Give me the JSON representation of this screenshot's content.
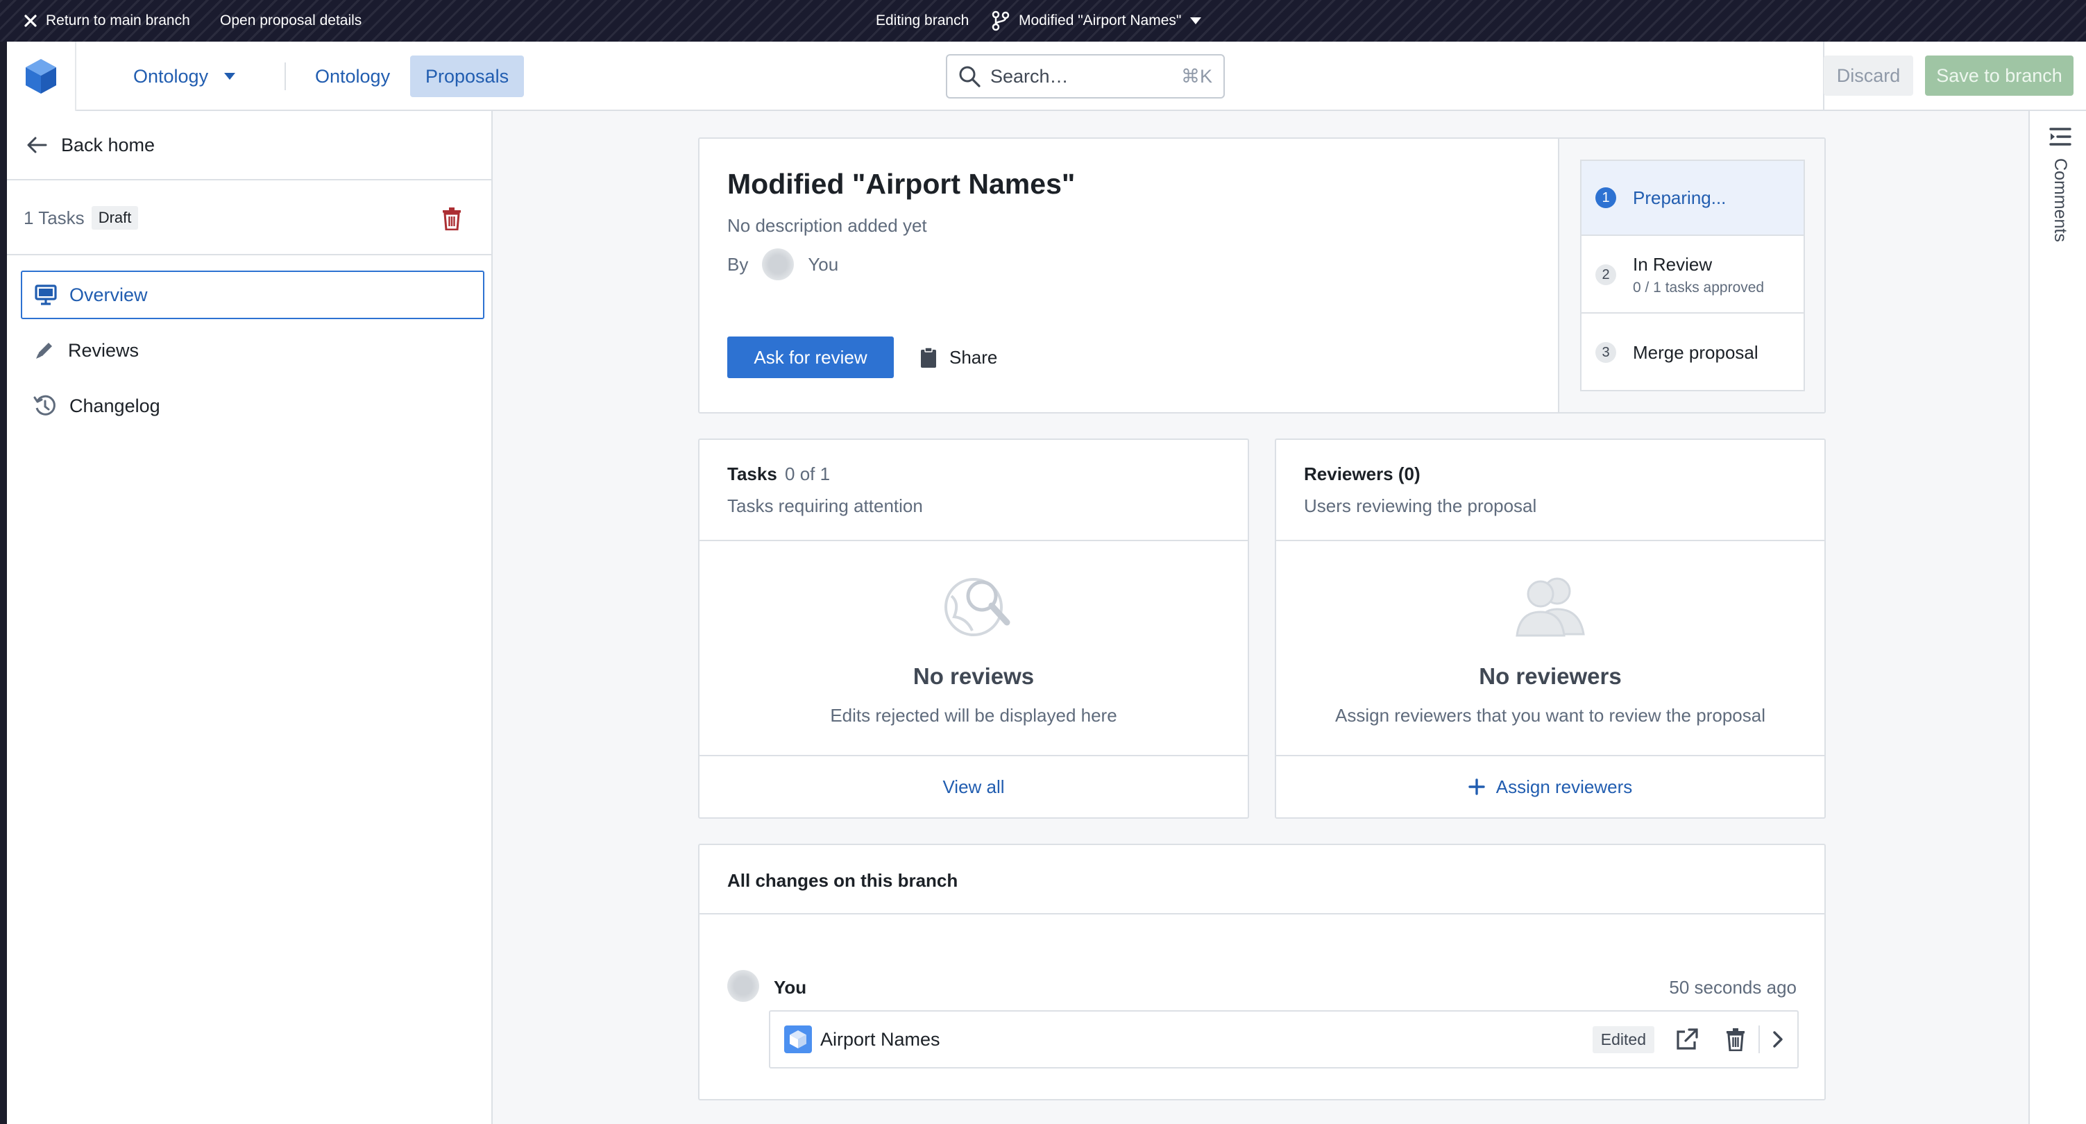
{
  "branch_bar": {
    "return_label": "Return to main branch",
    "open_details_label": "Open proposal details",
    "editing_label": "Editing branch",
    "branch_name": "Modified \"Airport Names\""
  },
  "nav": {
    "app_menu_label": "Ontology",
    "tabs": [
      {
        "label": "Ontology",
        "active": false
      },
      {
        "label": "Proposals",
        "active": true
      }
    ],
    "search": {
      "placeholder": "Search…",
      "shortcut": "⌘K"
    },
    "discard_label": "Discard",
    "save_label": "Save to branch"
  },
  "sidebar": {
    "back_label": "Back home",
    "tasks_count_label": "1 Tasks",
    "status_badge": "Draft",
    "items": [
      {
        "label": "Overview",
        "icon": "monitor-icon",
        "selected": true
      },
      {
        "label": "Reviews",
        "icon": "pencil-icon",
        "selected": false
      },
      {
        "label": "Changelog",
        "icon": "history-icon",
        "selected": false
      }
    ]
  },
  "proposal": {
    "title": "Modified \"Airport Names\"",
    "description": "No description added yet",
    "by_label": "By",
    "author": "You",
    "ask_review_label": "Ask for review",
    "share_label": "Share"
  },
  "steps": [
    {
      "number": "1",
      "label": "Preparing...",
      "sub": "",
      "active": true
    },
    {
      "number": "2",
      "label": "In Review",
      "sub": "0 / 1 tasks approved",
      "active": false
    },
    {
      "number": "3",
      "label": "Merge proposal",
      "sub": "",
      "active": false
    }
  ],
  "tasks_card": {
    "title": "Tasks",
    "count": "0 of 1",
    "subtitle": "Tasks requiring attention",
    "empty_title": "No reviews",
    "empty_text": "Edits rejected will be displayed here",
    "footer_label": "View all"
  },
  "reviewers_card": {
    "title": "Reviewers (0)",
    "subtitle": "Users reviewing the proposal",
    "empty_title": "No reviewers",
    "empty_text": "Assign reviewers that you want to review the proposal",
    "footer_label": "Assign reviewers"
  },
  "changes": {
    "title": "All changes on this branch",
    "author": "You",
    "time": "50 seconds ago",
    "item_name": "Airport Names",
    "item_status": "Edited"
  },
  "comments_label": "Comments",
  "colors": {
    "accent": "#2d72d2",
    "link": "#215db0",
    "save_disabled": "#9fc5a4",
    "danger": "#ac2f33",
    "branch_bar": "#1a1b2e"
  }
}
